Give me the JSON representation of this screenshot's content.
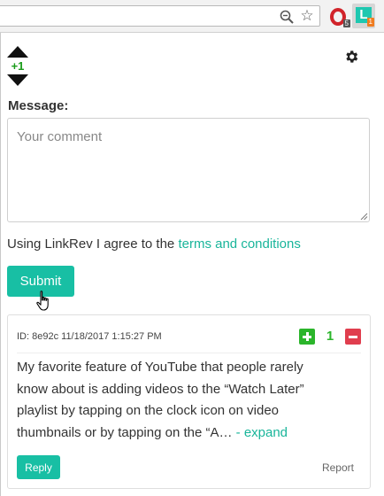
{
  "toolbar": {
    "icons": [
      "zoom-icon",
      "star-icon"
    ],
    "extensions": [
      {
        "name": "opera-extension",
        "badge": "5"
      },
      {
        "name": "linkrev-extension",
        "logo": "L",
        "badge": "1"
      }
    ]
  },
  "popup": {
    "score": "+1",
    "message_label": "Message:",
    "comment_placeholder": "Your comment",
    "terms_prefix": "Using LinkRev I agree to the ",
    "terms_link": "terms and conditions",
    "submit_label": "Submit"
  },
  "comment": {
    "meta": "ID: 8e92c 11/18/2017 1:15:27 PM",
    "votes": "1",
    "body": "My favorite feature of YouTube that people rarely know about is adding videos to the “Watch Later” playlist by tapping on the clock icon on video thumbnails or by tapping on the “A…",
    "expand_label": " - expand",
    "reply_label": "Reply",
    "report_label": "Report"
  },
  "colors": {
    "accent": "#18bfa4",
    "upvote": "#2bb52b",
    "downvote": "#e03e4e",
    "badge_orange": "#f07c20"
  }
}
